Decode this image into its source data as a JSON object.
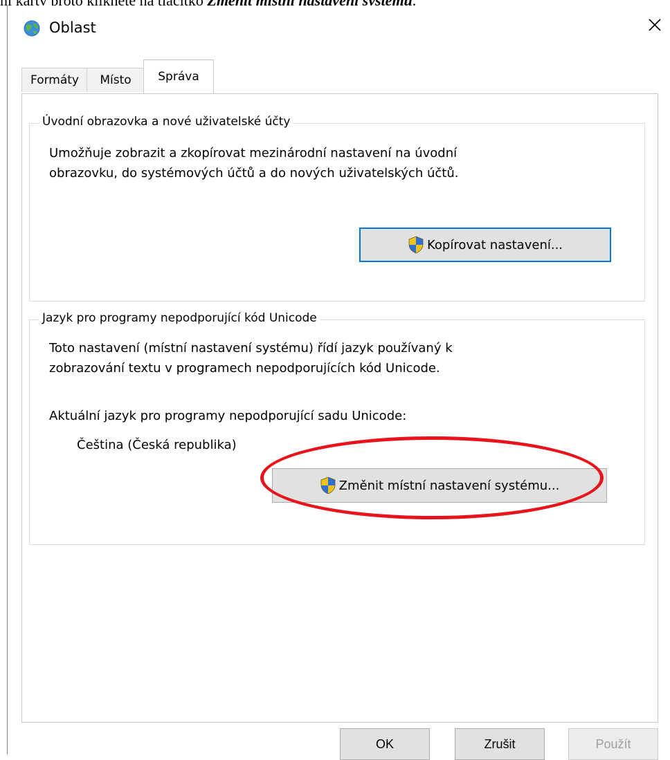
{
  "top_caption": {
    "text_prefix": "ní karty proto klikněte na tlačítko ",
    "text_emphasis": "Změnit místní nastavení systému",
    "text_suffix": "."
  },
  "window": {
    "title": "Oblast",
    "app_icon": "globe-icon",
    "close_glyph": "✕"
  },
  "tabs": [
    {
      "label": "Formáty",
      "active": false
    },
    {
      "label": "Místo",
      "active": false
    },
    {
      "label": "Správa",
      "active": true
    }
  ],
  "group_welcome": {
    "title": "Úvodní obrazovka a nové uživatelské účty",
    "description_line1": "Umožňuje zobrazit a zkopírovat mezinárodní nastavení na úvodní",
    "description_line2": "obrazovku, do systémových účtů a do nových uživatelských účtů.",
    "button_label": "Kopírovat nastavení...",
    "button_icon": "uac-shield-icon"
  },
  "group_unicode": {
    "title": "Jazyk pro programy nepodporující kód Unicode",
    "description_line1": "Toto nastavení (místní nastavení systému) řídí jazyk používaný k",
    "description_line2": "zobrazování textu v programech nepodporujících kód Unicode.",
    "current_label": "Aktuální jazyk pro programy nepodporující sadu Unicode:",
    "current_value": "Čeština (Česká republika)",
    "button_label": "Změnit místní nastavení systému...",
    "button_icon": "uac-shield-icon"
  },
  "annotation": {
    "color": "#e8141b"
  },
  "footer": {
    "ok_label": "OK",
    "cancel_label": "Zrušit",
    "apply_label": "Použít",
    "apply_enabled": false
  },
  "colors": {
    "focus_border": "#0078d7",
    "button_face": "#e1e1e1"
  }
}
